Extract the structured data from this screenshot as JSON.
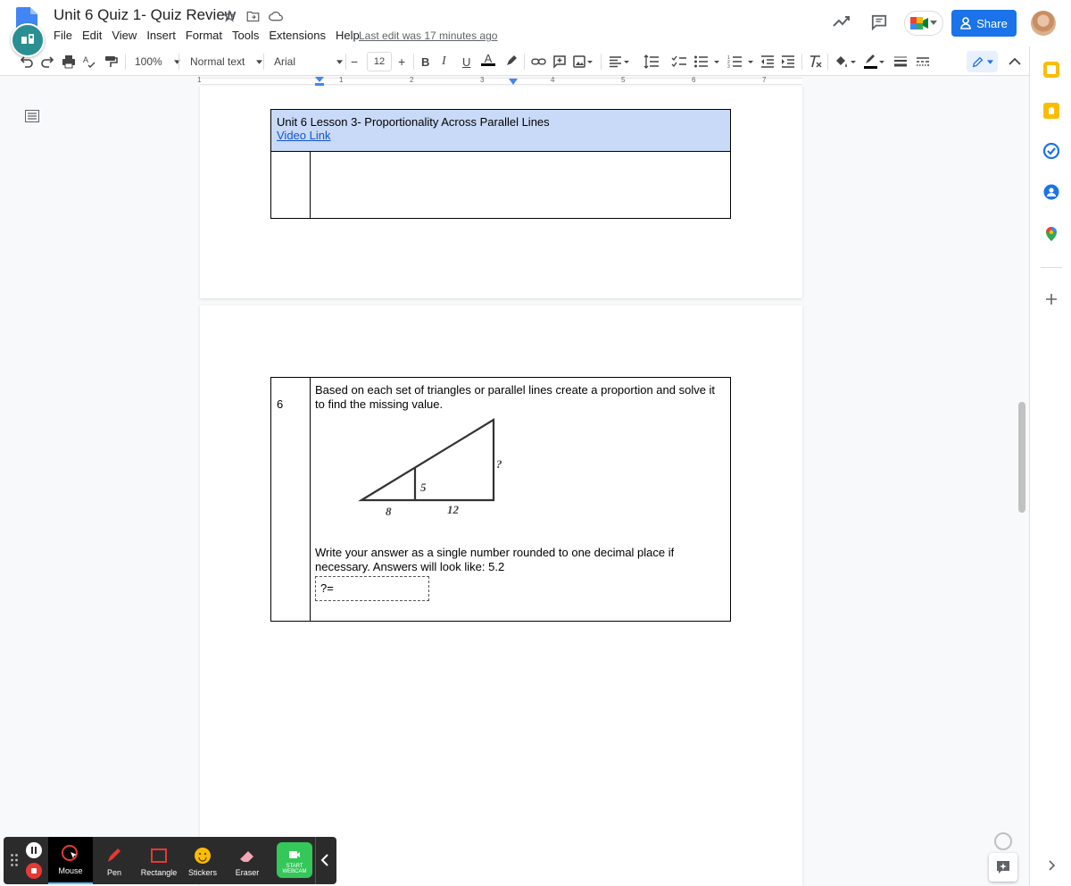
{
  "header": {
    "title": "Unit 6 Quiz 1- Quiz Review",
    "menus": [
      "File",
      "Edit",
      "View",
      "Insert",
      "Format",
      "Tools",
      "Extensions",
      "Help"
    ],
    "last_edit": "Last edit was 17 minutes ago",
    "share_label": "Share"
  },
  "toolbar": {
    "zoom": "100%",
    "style": "Normal text",
    "font": "Arial",
    "font_size": "12",
    "bold": "B",
    "italic": "I",
    "underline": "U",
    "text_color": "A"
  },
  "ruler": {
    "numbers": [
      "1",
      "1",
      "2",
      "3",
      "4",
      "5",
      "6",
      "7"
    ]
  },
  "page1": {
    "header_title": "Unit 6 Lesson 3- Proportionality Across Parallel Lines",
    "video_link": "Video Link",
    "header_bg": "#c9daf8"
  },
  "page2": {
    "question_number": "6",
    "question_text": "Based on each set of triangles or parallel lines create a proportion and solve it to find the missing value.",
    "figure": {
      "label_left_base": "8",
      "label_right_base": "12",
      "label_inner_height": "5",
      "label_unknown": "?"
    },
    "instructions": "Write your answer as a single number rounded to one decimal place if necessary. Answers will look like: 5.2",
    "answer_prompt": "?="
  },
  "recorder": {
    "items": [
      "Mouse",
      "Pen",
      "Rectangle",
      "Stickers",
      "Eraser"
    ],
    "webcam_label_1": "START",
    "webcam_label_2": "WEBCAM"
  },
  "colors": {
    "accent": "#1a73e8",
    "table_header": "#c9daf8",
    "link": "#1155cc"
  }
}
